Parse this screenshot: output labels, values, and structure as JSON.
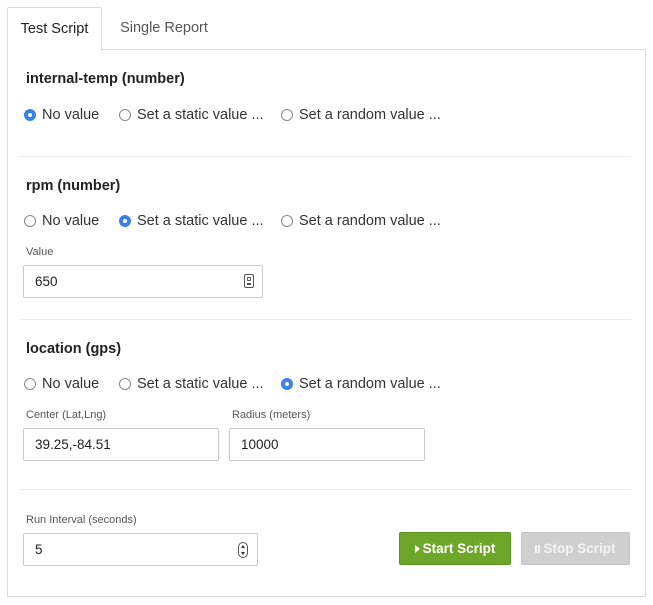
{
  "tabs": [
    {
      "label": "Test Script",
      "active": true
    },
    {
      "label": "Single Report",
      "active": false
    }
  ],
  "radio_options": {
    "no_value": "No value",
    "static": "Set a static value ...",
    "random": "Set a random value ..."
  },
  "attributes": [
    {
      "title": "internal-temp (number)",
      "selected": "no_value"
    },
    {
      "title": "rpm (number)",
      "selected": "static",
      "value_label": "Value",
      "value": "650"
    },
    {
      "title": "location (gps)",
      "selected": "random",
      "center_label": "Center (Lat,Lng)",
      "center_value": "39.25,-84.51",
      "radius_label": "Radius (meters)",
      "radius_value": "10000"
    }
  ],
  "run_interval": {
    "label": "Run Interval (seconds)",
    "value": "5"
  },
  "buttons": {
    "start_label": "Start Script",
    "stop_label": "Stop Script"
  },
  "colors": {
    "accent_radio": "#3b82e6",
    "start_button": "#6ea62a",
    "stop_button_disabled": "#cfcfcf"
  }
}
